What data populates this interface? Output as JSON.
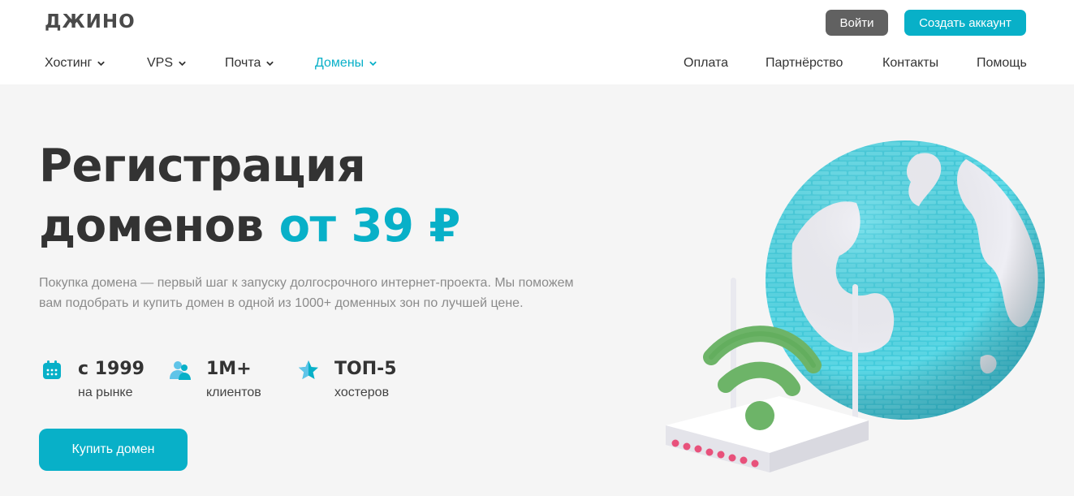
{
  "header": {
    "logo": "ДЖИНО",
    "login_label": "Войти",
    "signup_label": "Создать аккаунт"
  },
  "nav": {
    "left": [
      {
        "label": "Хостинг",
        "dropdown": true
      },
      {
        "label": "VPS",
        "dropdown": true
      },
      {
        "label": "Почта",
        "dropdown": true
      },
      {
        "label": "Домены",
        "dropdown": true,
        "active": true
      }
    ],
    "right": [
      {
        "label": "Оплата"
      },
      {
        "label": "Партнёрство"
      },
      {
        "label": "Контакты"
      },
      {
        "label": "Помощь"
      }
    ]
  },
  "hero": {
    "title_line1": "Регистрация",
    "title_line2": "доменов",
    "title_accent": "от 39 ₽",
    "description": "Покупка домена — первый шаг к запуску долгосрочного интернет-проекта. Мы поможем вам подобрать и купить домен в одной из 1000+ доменных зон по лучшей цене.",
    "stats": [
      {
        "icon": "calendar-icon",
        "value": "с 1999",
        "label": "на рынке"
      },
      {
        "icon": "users-icon",
        "value": "1M+",
        "label": "клиентов"
      },
      {
        "icon": "star-icon",
        "value": "ТОП-5",
        "label": "хостеров"
      }
    ],
    "buy_label": "Купить домен"
  },
  "colors": {
    "accent": "#08b0c8",
    "dark_button": "#616161",
    "text": "#333333",
    "muted": "#8b8b8b",
    "background": "#f5f5f5"
  }
}
